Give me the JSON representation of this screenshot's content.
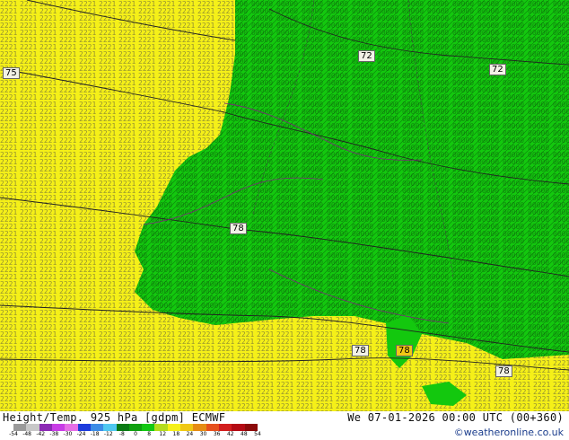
{
  "map": {
    "contour_labels": [
      "75",
      "72",
      "72",
      "78",
      "78",
      "78",
      "78"
    ],
    "regions": {
      "yellow": "#f5f018",
      "green": "#13c80e",
      "dark_green": "#0d8c13"
    }
  },
  "footer": {
    "title": "Height/Temp. 925 hPa [gdpm] ECMWF",
    "date": "We 07-01-2026 00:00 UTC (00+360)",
    "credit": "©weatheronline.co.uk"
  },
  "colorbar": {
    "ticks": [
      "-54",
      "-48",
      "-42",
      "-38",
      "-30",
      "-24",
      "-18",
      "-12",
      "-8",
      "0",
      "8",
      "12",
      "18",
      "24",
      "30",
      "36",
      "42",
      "48",
      "54"
    ],
    "colors": [
      "#9a9a9a",
      "#c8c8c8",
      "#8c2ab4",
      "#c83ce6",
      "#e66ee6",
      "#1e3cdc",
      "#3c8ce6",
      "#50c8f0",
      "#0a7a14",
      "#10a010",
      "#14c814",
      "#b4dc1e",
      "#f5f018",
      "#f0c814",
      "#e68c14",
      "#e6501e",
      "#d21e1e",
      "#b40a14",
      "#8c0a0a"
    ]
  }
}
